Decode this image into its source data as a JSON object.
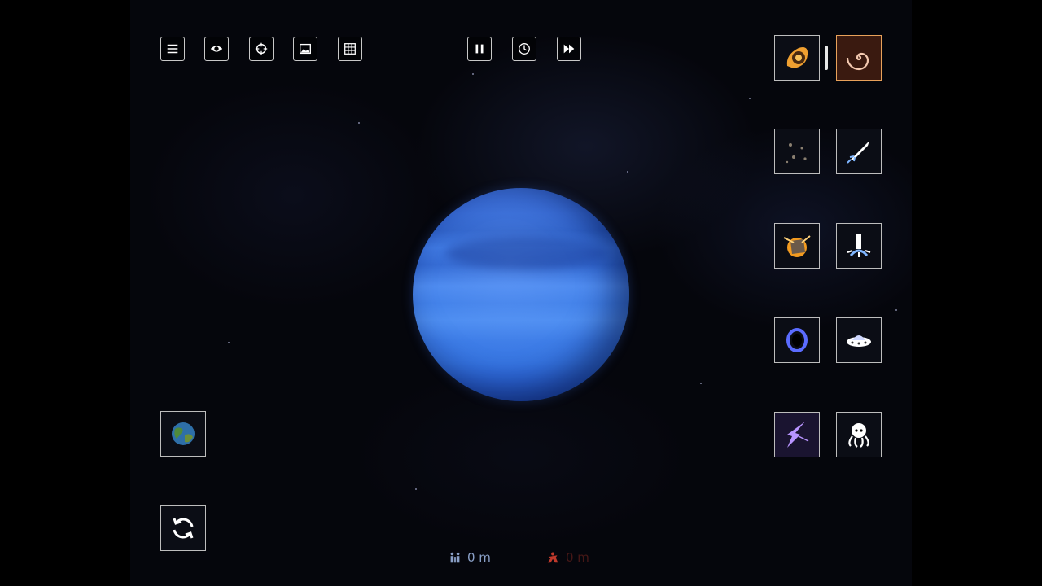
{
  "toolbar": {
    "left": [
      {
        "name": "menu",
        "icon": "menu-icon"
      },
      {
        "name": "visibility",
        "icon": "eye-icon"
      },
      {
        "name": "target",
        "icon": "crosshair-icon"
      },
      {
        "name": "screenshot",
        "icon": "image-icon"
      },
      {
        "name": "grid",
        "icon": "grid-icon"
      }
    ],
    "center": [
      {
        "name": "pause",
        "icon": "pause-icon"
      },
      {
        "name": "time",
        "icon": "clock-icon"
      },
      {
        "name": "fast-forward",
        "icon": "fast-forward-icon"
      }
    ]
  },
  "tools": [
    {
      "name": "asteroid",
      "icon": "meteor-icon"
    },
    {
      "name": "galaxy-swirl",
      "icon": "spiral-galaxy-icon",
      "selected": true
    },
    {
      "name": "small-asteroids",
      "icon": "particles-icon"
    },
    {
      "name": "missile",
      "icon": "missile-icon"
    },
    {
      "name": "explosion-rock",
      "icon": "impact-icon"
    },
    {
      "name": "freeze-beam",
      "icon": "freeze-ray-icon"
    },
    {
      "name": "black-hole",
      "icon": "black-hole-icon"
    },
    {
      "name": "ufo",
      "icon": "ufo-icon"
    },
    {
      "name": "lightning",
      "icon": "lightning-icon"
    },
    {
      "name": "alien-octopus",
      "icon": "octopus-icon"
    }
  ],
  "left_panel": {
    "planet_select": {
      "icon": "earth-icon"
    },
    "reset": {
      "icon": "refresh-icon"
    }
  },
  "stats": {
    "population": {
      "icon": "people-icon",
      "value": "0 m",
      "color": "#8aa0c8"
    },
    "casualties": {
      "icon": "casualty-icon",
      "value": "0 m",
      "color": "#c0392b"
    }
  },
  "colors": {
    "planet": "#3b7ae6",
    "selected_tool_border": "#e8a15a"
  }
}
